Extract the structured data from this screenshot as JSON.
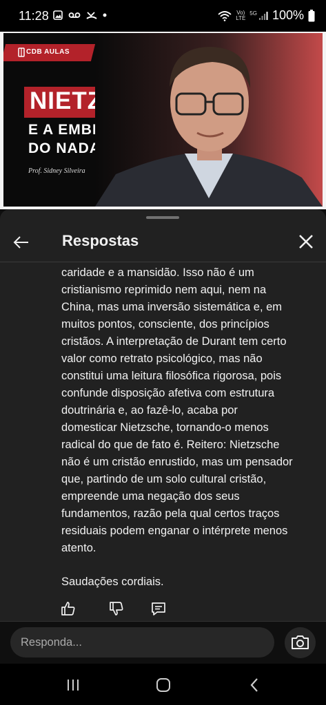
{
  "status_bar": {
    "time": "11:28",
    "network": "5G",
    "volte_top": "Vo)",
    "volte_bottom": "LTE",
    "battery": "100%"
  },
  "video": {
    "brand": "CDB AULAS",
    "title_line1": "NIETZSCHE",
    "title_line2": "E A EMBRIAGUEZ",
    "title_line3": "DO NADA",
    "author": "Prof. Sidney Silveira"
  },
  "panel": {
    "title": "Respostas",
    "back_icon": "back-arrow-icon",
    "close_icon": "close-icon"
  },
  "reply": {
    "lines": [
      "caridade e a mansidão. Isso não é um",
      "cristianismo reprimido nem aqui, nem na",
      "China, mas uma inversão sistemática e, em",
      "muitos pontos, consciente, dos princípios",
      "cristãos. A interpretação de Durant tem certo",
      "valor como retrato psicológico, mas não",
      "constitui uma leitura filosófica rigorosa, pois",
      "confunde disposição afetiva com estrutura",
      "doutrinária e, ao fazê-lo, acaba por",
      "domesticar Nietzsche, tornando-o menos",
      "radical do que de fato é. Reitero: Nietzsche",
      "não é um cristão enrustido, mas um pensador",
      "que, partindo de um solo cultural cristão,",
      "empreende uma negação dos seus",
      "fundamentos, razão pela qual certos traços",
      "residuais podem enganar o intérprete menos",
      "atento."
    ],
    "greeting": "Saudações cordiais."
  },
  "composer": {
    "placeholder": "Responda..."
  },
  "colors": {
    "brand_red": "#b3222a",
    "sheet_bg": "#212121",
    "input_bg": "#272727"
  }
}
